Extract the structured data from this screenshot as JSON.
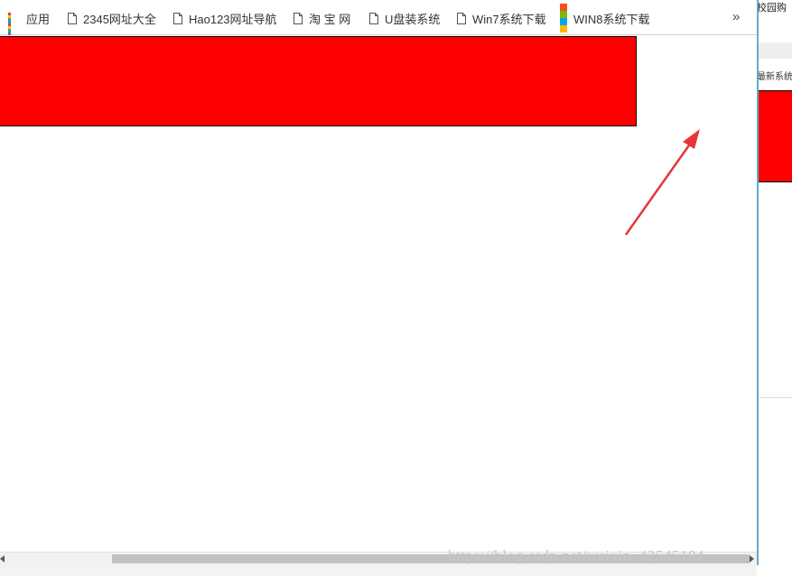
{
  "bookmarks_bar": {
    "items": [
      {
        "label": "应用",
        "icon": "apps-icon"
      },
      {
        "label": "2345网址大全",
        "icon": "page-icon"
      },
      {
        "label": "Hao123网址导航",
        "icon": "page-icon"
      },
      {
        "label": "淘 宝 网",
        "icon": "page-icon"
      },
      {
        "label": "U盘装系统",
        "icon": "page-icon"
      },
      {
        "label": "Win7系统下载",
        "icon": "page-icon"
      },
      {
        "label": "WIN8系统下载",
        "icon": "windows-logo-icon"
      }
    ],
    "overflow_label": "»"
  },
  "background_window": {
    "top_text": "校园购",
    "side_text": "最新系统下"
  },
  "watermark": "https://blog.csdn.net/weixin_42545184",
  "colors": {
    "red_box": "#ff0000",
    "arrow": "#e83535",
    "window_border": "#5ab0c9"
  }
}
